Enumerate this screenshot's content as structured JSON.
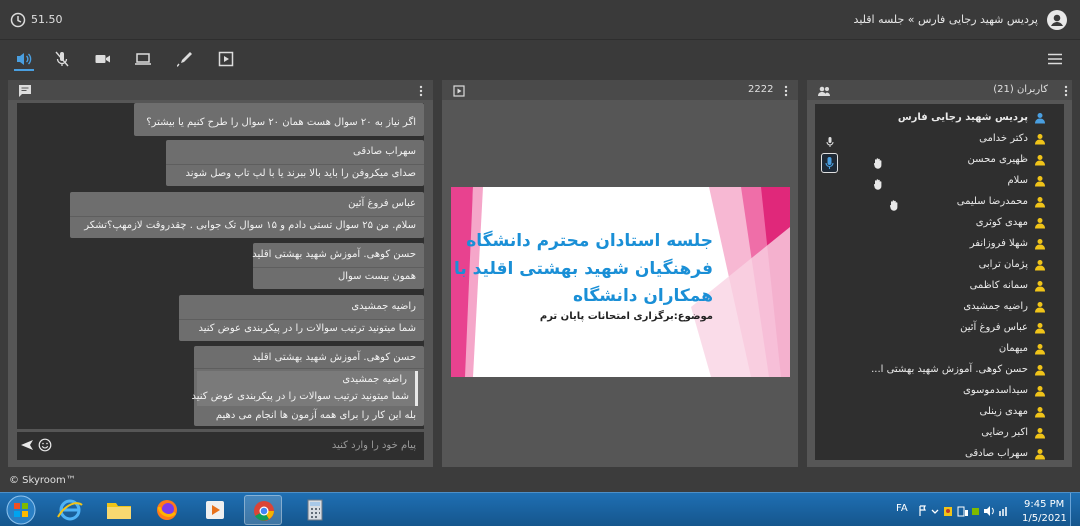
{
  "header": {
    "breadcrumb": "پردیس شهید رجایی فارس » جلسه اقلید",
    "timer": "51.50"
  },
  "chat": {
    "placeholder": "پیام خود را وارد کنید",
    "messages": [
      {
        "sender": "",
        "text": "اگر نیاز به ۲۰ سوال هست همان ۲۰ سوال را طرح کنیم یا بیشتر؟"
      },
      {
        "sender": "سهراب صادقی",
        "text": "صدای میکروفن را باید بالا ببرند یا با لپ تاپ وصل شوند"
      },
      {
        "sender": "عباس فروغ آئین",
        "text": "سلام.  من ۲۵ سوال تستی دادم و ۱۵ سوال تک جوابی .  چقدروقت لازمهپ؟تشکر"
      },
      {
        "sender": "حسن کوهی. آموزش شهید بهشتی اقلید",
        "text": "همون بیست سوال"
      },
      {
        "sender": "راضیه جمشیدی",
        "text": "شما میتونید ترتیب سوالات را در پیکربندی عوض کنید"
      },
      {
        "sender": "حسن کوهی. آموزش شهید بهشتی اقلید",
        "quote_sender": "راضیه جمشیدی",
        "quote_text": "شما میتونید ترتیب سوالات را در پیکربندی عوض کنید",
        "text": "بله این کار را برای همه آزمون ها انجام می دهیم"
      }
    ]
  },
  "presentation": {
    "title": "2222",
    "slide_heading_1": "جلسه استادان محترم دانشگاه",
    "slide_heading_2": "فرهنگیان شهید بهشتی اقلید با",
    "slide_heading_3": "همکاران دانشگاه",
    "slide_subject": "موضوع:برگزاری امتحانات پایان ترم"
  },
  "users": {
    "title": "کاربران (21)",
    "list": [
      "پردیس شهید رجایی فارس",
      "دکتر خدامی",
      "ظهیری محسن",
      "سلام",
      "محمدرضا سلیمی",
      "مهدی کوثری",
      "شهلا فروزانفر",
      "پژمان ترابی",
      "سمانه کاظمی",
      "راضیه جمشیدی",
      "عباس فروغ آئین",
      "میهمان",
      "حسن کوهی. آموزش شهید بهشتی ا...",
      "سیداسدموسوی",
      "مهدی زینلی",
      "اکبر رضایی",
      "سهراب صادقی"
    ]
  },
  "footer": {
    "brand": "© Skyroom™"
  },
  "taskbar": {
    "lang": "FA",
    "time": "9:45 PM",
    "date": "1/5/2021"
  },
  "colors": {
    "accent": "#4a9fe0",
    "user_icon": "#f0c419",
    "slide_text": "#1a8fd6",
    "slide_pink": "#e8428f"
  }
}
